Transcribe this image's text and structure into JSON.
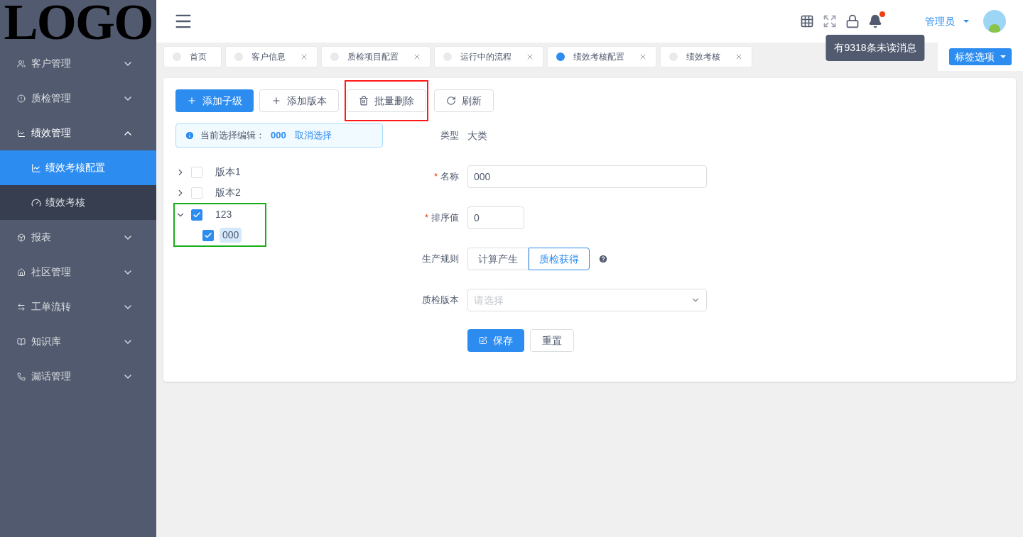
{
  "logo": "LOGO",
  "sidebar": {
    "items": [
      {
        "label": "客户管理",
        "expanded": false,
        "selected": false
      },
      {
        "label": "质检管理",
        "expanded": false,
        "selected": false
      },
      {
        "label": "绩效管理",
        "expanded": true,
        "selected": false,
        "children": [
          {
            "label": "绩效考核配置",
            "selected": true
          },
          {
            "label": "绩效考核",
            "selected": false
          }
        ]
      },
      {
        "label": "报表",
        "expanded": false,
        "selected": false
      },
      {
        "label": "社区管理",
        "expanded": false,
        "selected": false
      },
      {
        "label": "工单流转",
        "expanded": false,
        "selected": false
      },
      {
        "label": "知识库",
        "expanded": false,
        "selected": false
      },
      {
        "label": "漏话管理",
        "expanded": false,
        "selected": false
      }
    ]
  },
  "header": {
    "user": "管理员",
    "notification_tooltip": "有9318条未读消息"
  },
  "tabs": [
    {
      "label": "首页",
      "selected": false,
      "closable": false
    },
    {
      "label": "客户信息",
      "selected": false,
      "closable": true
    },
    {
      "label": "质检项目配置",
      "selected": false,
      "closable": true
    },
    {
      "label": "运行中的流程",
      "selected": false,
      "closable": true
    },
    {
      "label": "绩效考核配置",
      "selected": true,
      "closable": true
    },
    {
      "label": "绩效考核",
      "selected": false,
      "closable": true
    }
  ],
  "tab_options": "标签选项",
  "toolbar": [
    {
      "label": "添加子级",
      "kind": "primary"
    },
    {
      "label": "添加版本",
      "kind": "default"
    },
    {
      "label": "批量删除",
      "kind": "default"
    },
    {
      "label": "刷新",
      "kind": "default"
    }
  ],
  "selection_alert": {
    "prefix": "当前选择编辑：",
    "value": "000",
    "cancel": "取消选择"
  },
  "tree": [
    {
      "label": "版本1",
      "expanded": false,
      "checked": false
    },
    {
      "label": "版本2",
      "expanded": false,
      "checked": false
    },
    {
      "label": "123",
      "expanded": true,
      "checked": true,
      "children": [
        {
          "label": "000",
          "checked": true,
          "selected": true
        }
      ]
    }
  ],
  "form": {
    "fields": [
      {
        "kind": "text",
        "label": "类型",
        "value": "大类"
      },
      {
        "kind": "input",
        "label": "名称",
        "required_mark": "*",
        "value": "000"
      },
      {
        "kind": "input-short",
        "label": "排序值",
        "required_mark": "*",
        "value": "0"
      },
      {
        "kind": "radio",
        "label": "生产规则",
        "options": [
          {
            "label": "计算产生",
            "selected": false
          },
          {
            "label": "质检获得",
            "selected": true
          }
        ]
      },
      {
        "kind": "select",
        "label": "质检版本",
        "placeholder": "请选择"
      }
    ],
    "save": "保存",
    "reset": "重置"
  }
}
